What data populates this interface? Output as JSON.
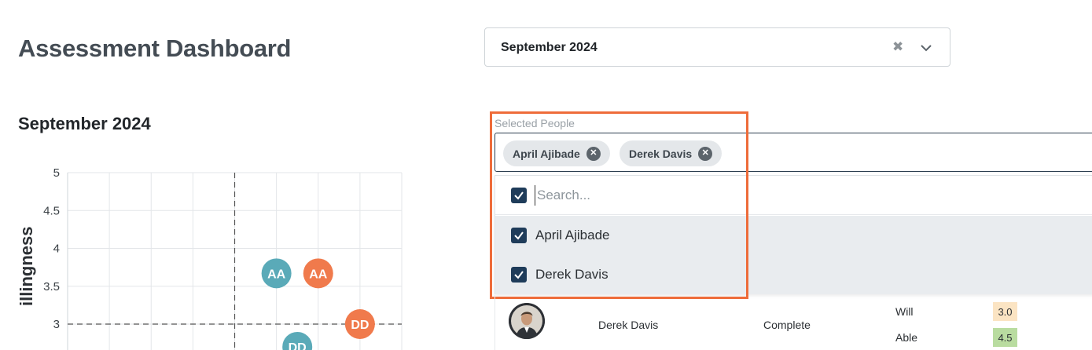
{
  "header": {
    "title": "Assessment Dashboard"
  },
  "period_select": {
    "value": "September 2024",
    "clear_icon": "close-icon",
    "toggle_icon": "chevron-down-icon"
  },
  "people_filter": {
    "label": "Selected People",
    "chips": [
      {
        "label": "April Ajibade",
        "remove_icon": "close-circle-icon"
      },
      {
        "label": "Derek Davis",
        "remove_icon": "close-circle-icon"
      }
    ],
    "dropdown": {
      "search_placeholder": "Search...",
      "select_all_checked": true,
      "options": [
        {
          "label": "April Ajibade",
          "checked": true
        },
        {
          "label": "Derek Davis",
          "checked": true
        }
      ]
    }
  },
  "table": {
    "rows": [
      {
        "name": "Derek Davis",
        "status": "Complete",
        "metrics": [
          {
            "label": "Will",
            "value": "3.0",
            "color": "#fbe4c3"
          },
          {
            "label": "Able",
            "value": "4.5",
            "color": "#b9dca0"
          }
        ]
      }
    ]
  },
  "colors": {
    "accent_highlight": "#ee6c3a",
    "april_marker": "#5aaab8",
    "derek_marker": "#f07a4c",
    "checkbox": "#1f3c5a"
  },
  "chart_data": {
    "type": "scatter",
    "title": "September 2024",
    "xlabel": "",
    "ylabel": "illingness",
    "yticks": [
      "5",
      "4.5",
      "4",
      "3.5",
      "3"
    ],
    "ylim": [
      2.6,
      5
    ],
    "xlim": [
      0,
      4
    ],
    "x_reference": 2,
    "y_reference": 3,
    "grid": true,
    "series": [
      {
        "name": "",
        "points": [
          {
            "x": 2.5,
            "y": 3.67,
            "label": "AA",
            "color": "#5aaab8"
          },
          {
            "x": 3.0,
            "y": 3.67,
            "label": "AA",
            "color": "#f07a4c"
          }
        ]
      },
      {
        "name": "",
        "points": [
          {
            "x": 3.5,
            "y": 3.0,
            "label": "DD",
            "color": "#f07a4c"
          },
          {
            "x": 2.75,
            "y": 2.7,
            "label": "DD",
            "color": "#5aaab8"
          }
        ]
      }
    ]
  }
}
